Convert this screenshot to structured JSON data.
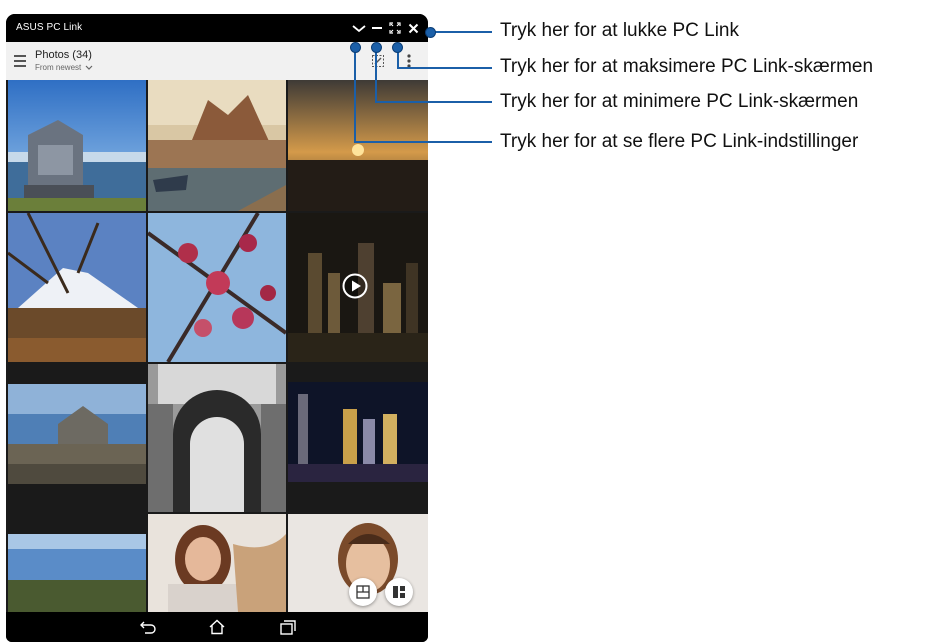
{
  "window": {
    "title": "ASUS PC Link"
  },
  "app_bar": {
    "title": "Photos (34)",
    "subtitle": "From newest"
  },
  "icons": {
    "window_controls": [
      "settings-chevron-icon",
      "minimize-icon",
      "maximize-icon",
      "close-icon"
    ],
    "app_bar": [
      "hamburger-menu-icon",
      "select-icon",
      "more-vert-icon"
    ],
    "grid_overlay": [
      "play-icon"
    ],
    "fabs": [
      "collage-icon",
      "layout-icon"
    ],
    "navigation": [
      "back-icon",
      "home-icon",
      "recent-apps-icon"
    ]
  },
  "callouts": [
    {
      "text": "Tryk her for at lukke PC Link",
      "target": "close-icon"
    },
    {
      "text": "Tryk her for at maksimere PC Link-skærmen",
      "target": "maximize-icon"
    },
    {
      "text": "Tryk her for at minimere PC Link-skærmen",
      "target": "minimize-icon"
    },
    {
      "text": "Tryk her for at se flere PC Link-indstillinger",
      "target": "settings-chevron-icon"
    }
  ],
  "colors": {
    "callout": "#1b5fa8",
    "titlebar": "#000000",
    "appbar": "#f1f1f1"
  }
}
